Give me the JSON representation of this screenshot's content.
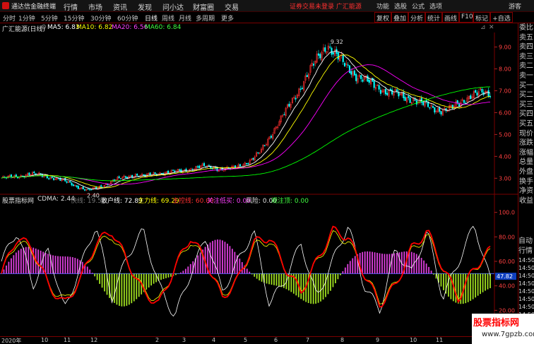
{
  "app": {
    "title": "通达信金融终端",
    "menu": [
      "行情",
      "市场",
      "资讯",
      "发现",
      "问小达",
      "财富圈",
      "交易"
    ],
    "notice": "证券交易未登录 广汇能源",
    "right_menu": [
      "功能",
      "选股",
      "公式",
      "选项",
      "游客"
    ]
  },
  "toolbar": {
    "tabs": [
      "分时",
      "1分钟",
      "5分钟",
      "15分钟",
      "30分钟",
      "60分钟",
      "日线",
      "周线",
      "月线",
      "多周期",
      "更多"
    ],
    "active_tab": "日线",
    "right_buttons": [
      "复权",
      "叠加",
      "分析",
      "统计",
      "画线",
      "F10",
      "标记",
      "+自选"
    ]
  },
  "main_chart": {
    "stock": "广汇能源(日线)",
    "ma5": "MA5: 6.83",
    "ma10": "MA10: 6.82",
    "ma20": "MA20: 6.56",
    "ma60": "MA60: 6.84",
    "y_ticks": [
      "9.00",
      "8.00",
      "7.00",
      "6.00",
      "5.00",
      "4.00",
      "3.00"
    ],
    "high_label": "9.32",
    "low_label": "2.40",
    "colors": {
      "ma5": "#ffffff",
      "ma10": "#ffff00",
      "ma20": "#ff00ff",
      "ma60": "#00ff00",
      "up": "#ff3030",
      "down": "#00ffff"
    }
  },
  "indicator": {
    "name": "股票指标网",
    "cdma": "CDMA: 2.44",
    "fast": "快线: 19.51",
    "retail": "散户线: 72.89",
    "main": "主力线: 69.29",
    "main_in": "主控线: 60.00",
    "attention": "关注低买: 0.00",
    "risk": "风险: 0.00",
    "watch": "观注顶: 0.00",
    "y_ticks": [
      "100.0",
      "80.00",
      "60.00",
      "40.00",
      "20.00"
    ],
    "current_value": "47.82",
    "colors": {
      "retail": "#ffffff",
      "main": "#ff0000",
      "yellow": "#ffff00",
      "hist_up": "#e040e0",
      "hist_down": "#a0e020"
    }
  },
  "right_panel": [
    "委比",
    "卖五",
    "卖四",
    "卖三",
    "卖二",
    "卖一",
    "买一",
    "买二",
    "买三",
    "买四",
    "买五",
    "现价",
    "涨跌",
    "涨幅",
    "总量",
    "外盘",
    "换手",
    "净资",
    "收益"
  ],
  "right_panel2": [
    "自动",
    "行情",
    "14:50",
    "14:50",
    "14:50",
    "14:50",
    "14:50",
    "14:50",
    "14:50",
    "14:50",
    "14:50",
    "14:50",
    "14:50"
  ],
  "bottom_axis": [
    "2020年",
    "10",
    "11",
    "12",
    "2",
    "3",
    "4",
    "5",
    "6",
    "7",
    "8",
    "9",
    "10",
    "11"
  ],
  "watermark": {
    "line1": "股票指标网",
    "line2": "www.7gpzb.com"
  },
  "chart_data": [
    {
      "type": "candlestick",
      "title": "广汇能源(日线)",
      "ylim": [
        2.3,
        9.6
      ],
      "close_path": [
        3.0,
        3.05,
        3.1,
        3.2,
        3.15,
        3.05,
        2.95,
        2.8,
        2.6,
        2.45,
        2.55,
        2.75,
        2.95,
        3.05,
        3.15,
        3.1,
        3.2,
        3.25,
        3.3,
        3.35,
        3.45,
        3.55,
        3.5,
        3.4,
        3.45,
        3.6,
        3.8,
        4.2,
        4.9,
        5.6,
        6.3,
        7.0,
        7.8,
        8.5,
        9.1,
        8.6,
        8.1,
        7.7,
        7.5,
        7.2,
        7.0,
        6.9,
        6.7,
        6.6,
        6.4,
        6.2,
        6.1,
        6.2,
        6.5,
        6.8,
        6.9,
        6.85
      ],
      "ma_series": [
        "MA5",
        "MA10",
        "MA20",
        "MA60"
      ]
    },
    {
      "type": "line",
      "title": "股票指标网",
      "ylim": [
        0,
        105
      ],
      "series": [
        {
          "name": "散户线",
          "values": [
            60,
            85,
            40,
            70,
            20,
            55,
            90,
            30,
            65,
            85,
            40,
            15,
            50,
            80,
            35,
            60,
            85,
            25,
            45,
            75,
            30,
            60,
            90,
            40,
            20,
            70,
            50,
            85,
            30,
            60,
            90,
            45
          ]
        },
        {
          "name": "主力线",
          "values": [
            50,
            80,
            70,
            40,
            25,
            45,
            75,
            85,
            60,
            35,
            25,
            55,
            80,
            60,
            30,
            45,
            75,
            80,
            55,
            35,
            60,
            85,
            80,
            50,
            25,
            40,
            70,
            85,
            55,
            30,
            55,
            69
          ]
        }
      ]
    }
  ]
}
